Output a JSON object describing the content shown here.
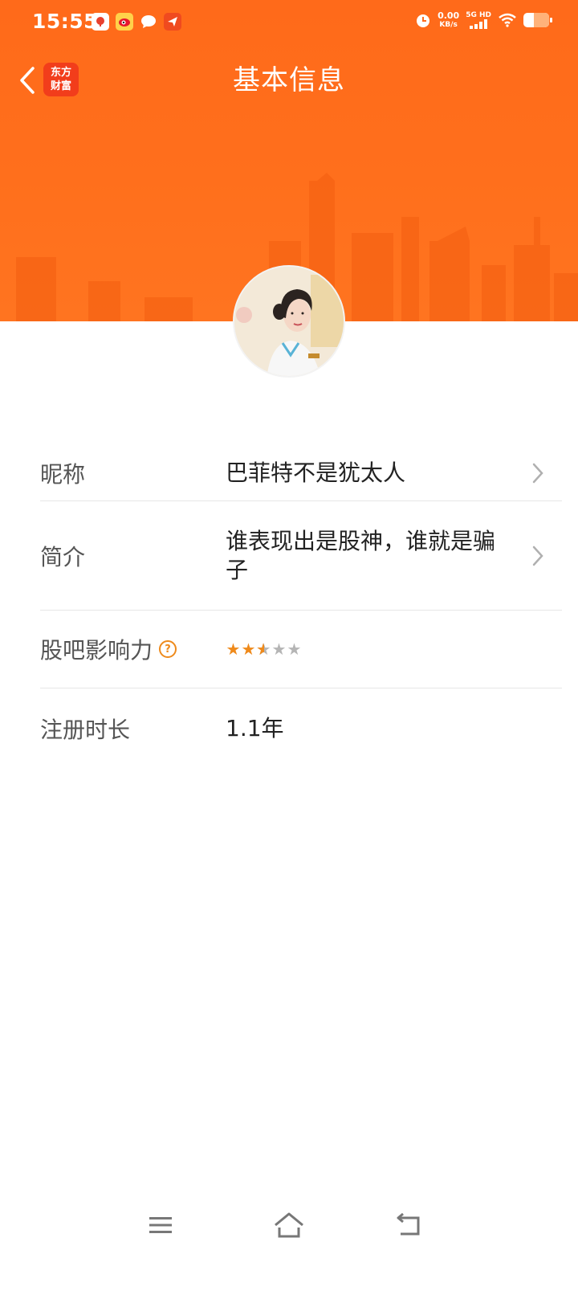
{
  "status_bar": {
    "time": "15:55",
    "net_speed_value": "0.00",
    "net_speed_unit": "KB/s",
    "network_type": "5G HD",
    "battery_percent": 40,
    "icons": [
      "notification-app-icon",
      "weibo-icon",
      "message-icon",
      "send-app-icon",
      "alarm-icon",
      "signal-icon",
      "wifi-icon",
      "battery-icon"
    ]
  },
  "nav": {
    "title": "基本信息",
    "logo_line1": "东方",
    "logo_line2": "财富"
  },
  "profile": {
    "rows": [
      {
        "label": "昵称",
        "value": "巴菲特不是犹太人",
        "has_arrow": true
      },
      {
        "label": "简介",
        "value": "谁表现出是股神，谁就是骗子",
        "has_arrow": true
      },
      {
        "label": "股吧影响力",
        "rating": 2.5,
        "rating_max": 5
      },
      {
        "label": "注册时长",
        "value": "1.1年"
      }
    ]
  },
  "colors": {
    "header_orange": "#ff6a1a",
    "logo_red": "#f23d1b",
    "star_orange": "#ef8a1b",
    "star_gray": "#b5b5b5"
  }
}
